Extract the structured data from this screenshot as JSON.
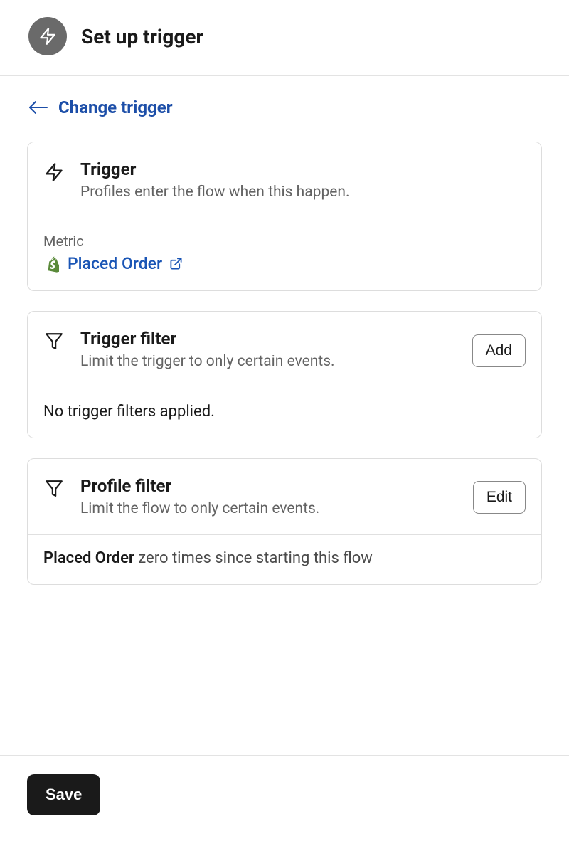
{
  "header": {
    "title": "Set up trigger"
  },
  "change_trigger_label": "Change trigger",
  "trigger_card": {
    "title": "Trigger",
    "subtitle": "Profiles enter the flow when this happen.",
    "metric_label": "Metric",
    "metric_value": "Placed Order"
  },
  "trigger_filter_card": {
    "title": "Trigger filter",
    "subtitle": "Limit the trigger to only certain events.",
    "button": "Add",
    "body": "No trigger filters applied."
  },
  "profile_filter_card": {
    "title": "Profile filter",
    "subtitle": "Limit the flow to only certain events.",
    "button": "Edit",
    "body_bold": "Placed Order",
    "body_rest": " zero times since starting this flow"
  },
  "footer": {
    "save_label": "Save"
  }
}
